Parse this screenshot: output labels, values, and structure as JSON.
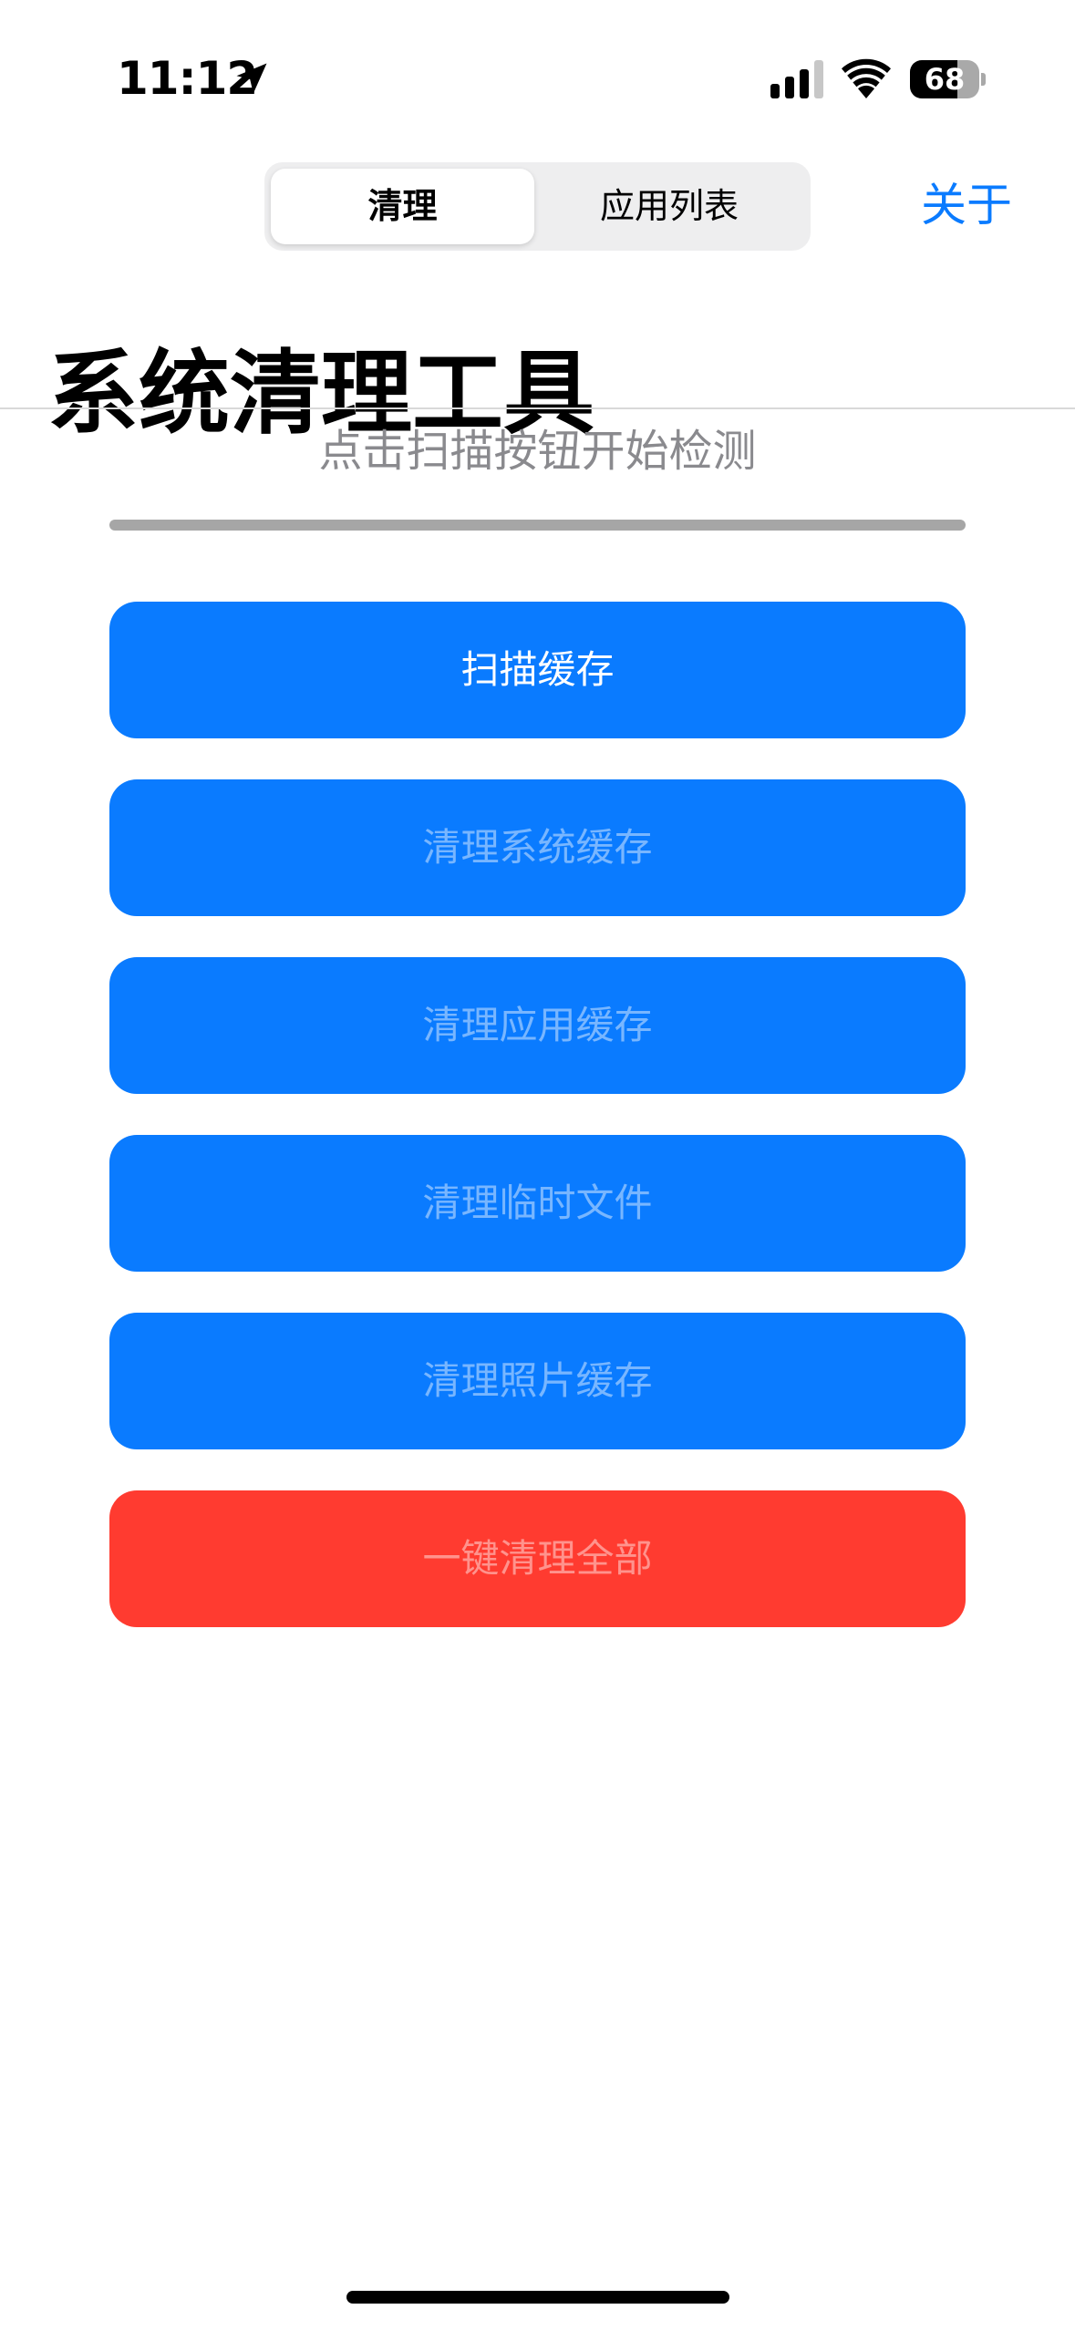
{
  "status_bar": {
    "time": "11:12",
    "battery_percent": "68",
    "battery_level": 0.68,
    "icons": [
      "location-arrow-icon",
      "cellular-signal-icon",
      "wifi-icon",
      "battery-icon"
    ]
  },
  "nav": {
    "segments": [
      {
        "label": "清理",
        "selected": true
      },
      {
        "label": "应用列表",
        "selected": false
      }
    ],
    "about_label": "关于"
  },
  "page": {
    "title": "系统清理工具",
    "status_text": "点击扫描按钮开始检测",
    "progress": 0
  },
  "actions": [
    {
      "label": "扫描缓存",
      "enabled": true
    },
    {
      "label": "清理系统缓存",
      "enabled": false
    },
    {
      "label": "清理应用缓存",
      "enabled": false
    },
    {
      "label": "清理临时文件",
      "enabled": false
    },
    {
      "label": "清理照片缓存",
      "enabled": false
    },
    {
      "label": "一键清理全部",
      "enabled": false,
      "style": "destructive"
    }
  ],
  "colors": {
    "accent": "#0a7bff",
    "destructive": "#ff3b30",
    "progress_track": "#a6a6a6",
    "secondary_text": "#8a8a8e"
  }
}
